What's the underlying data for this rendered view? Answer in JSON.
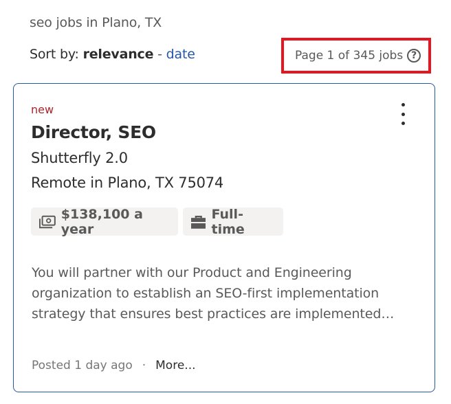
{
  "search": {
    "context_text": "seo jobs in Plano, TX"
  },
  "sort": {
    "prefix": "Sort by: ",
    "active_label": "relevance",
    "separator": " - ",
    "alt_link_label": "date"
  },
  "pagination": {
    "page_count_text": "Page 1 of 345 jobs",
    "help_glyph": "?"
  },
  "job": {
    "badge": "new",
    "title": "Director, SEO",
    "company": "Shutterfly 2.0",
    "location": "Remote in Plano, TX 75074",
    "salary": "$138,100 a year",
    "job_type": "Full-time",
    "snippet": "You will partner with our Product and Engineering organization to establish an SEO-first implementation strategy that ensures best practices are implemented…",
    "posted": "Posted 1 day ago",
    "separator_dot": "·",
    "more_label": "More..."
  },
  "icons": {
    "salary": "money-icon",
    "job_type": "briefcase-icon",
    "menu": "more-vertical-icon",
    "help": "help-circle-icon"
  },
  "colors": {
    "link": "#2557a7",
    "new_badge": "#a9252b",
    "highlight_box": "#e8141e",
    "tag_bg": "#f3f2f1"
  }
}
